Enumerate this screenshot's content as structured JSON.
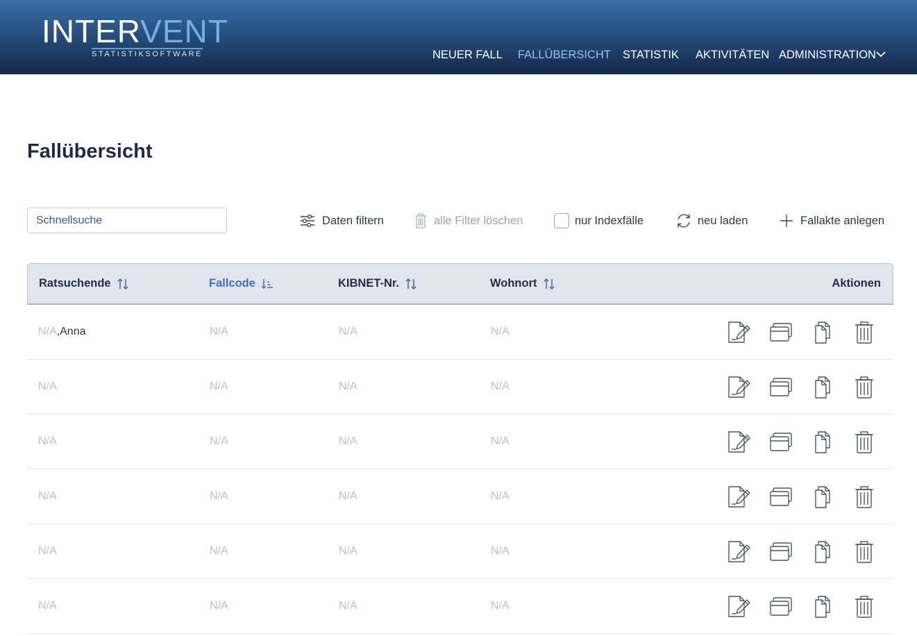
{
  "logo": {
    "part_white": "INTER",
    "part_blue": "VENT",
    "subtitle": "STATISTIKSOFTWARE"
  },
  "nav": {
    "items": [
      {
        "label": "NEUER FALL",
        "active": false
      },
      {
        "label": "FALLÜBERSICHT",
        "active": true
      },
      {
        "label": "STATISTIK",
        "active": false
      },
      {
        "label": "AKTIVITÄTEN",
        "active": false
      },
      {
        "label": "ADMINISTRATION",
        "active": false,
        "icon": "chevron-down-icon"
      }
    ]
  },
  "page": {
    "title": "Fallübersicht"
  },
  "toolbar": {
    "search_placeholder": "Schnellsuche",
    "filter_label": "Daten filtern",
    "clear_filters_label": "alle Filter löschen",
    "index_only_label": "nur Indexfälle",
    "index_only_checked": false,
    "reload_label": "neu laden",
    "create_label": "Fallakte anlegen"
  },
  "table": {
    "columns": [
      {
        "label": "Ratsuchende",
        "sort": "none"
      },
      {
        "label": "Fallcode",
        "sort": "descending"
      },
      {
        "label": "KIBNET-Nr.",
        "sort": "none"
      },
      {
        "label": "Wohnort",
        "sort": "none"
      }
    ],
    "actions_label": "Aktionen",
    "action_icons": [
      "edit-document-icon",
      "open-window-icon",
      "copy-icon",
      "trash-icon"
    ],
    "rows": [
      {
        "last": "N/A",
        "sep": ",",
        "first": "Anna",
        "fallcode": "N/A",
        "kibnet": "N/A",
        "wohnort": "N/A"
      },
      {
        "last": "N/A",
        "sep": "",
        "first": "",
        "fallcode": "N/A",
        "kibnet": "N/A",
        "wohnort": "N/A"
      },
      {
        "last": "N/A",
        "sep": "",
        "first": "",
        "fallcode": "N/A",
        "kibnet": "N/A",
        "wohnort": "N/A"
      },
      {
        "last": "N/A",
        "sep": "",
        "first": "",
        "fallcode": "N/A",
        "kibnet": "N/A",
        "wohnort": "N/A"
      },
      {
        "last": "N/A",
        "sep": "",
        "first": "",
        "fallcode": "N/A",
        "kibnet": "N/A",
        "wohnort": "N/A"
      },
      {
        "last": "N/A",
        "sep": "",
        "first": "",
        "fallcode": "N/A",
        "kibnet": "N/A",
        "wohnort": "N/A"
      }
    ]
  },
  "colors": {
    "header_top": "#3a6fa6",
    "header_bottom": "#142848",
    "nav_active": "#8ec5f2",
    "accent_blue": "#3a74b2",
    "placeholder_text": "#b7bec9"
  }
}
